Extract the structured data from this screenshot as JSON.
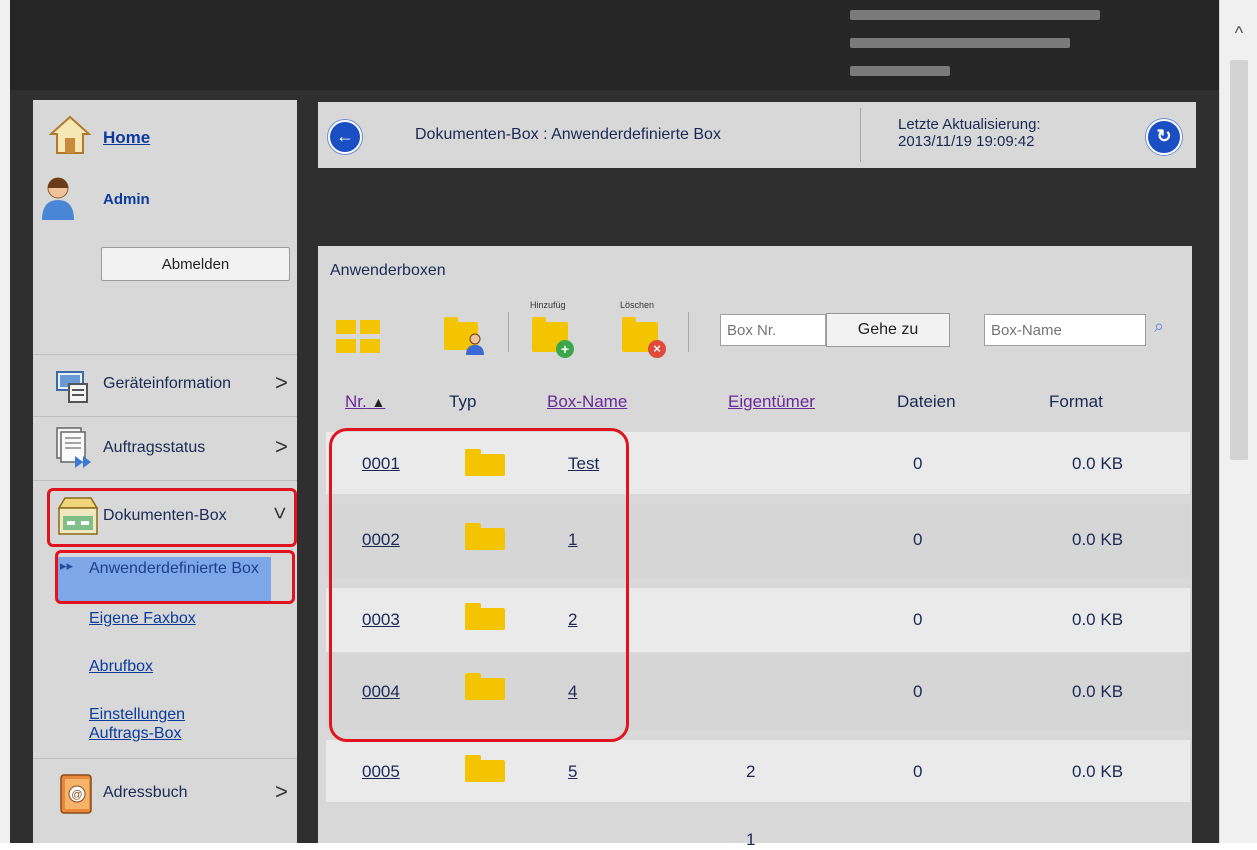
{
  "header": {
    "title": "Dokumenten-Box : Anwenderdefinierte Box",
    "update_label": "Letzte Aktualisierung:",
    "update_time": "2013/11/19 19:09:42"
  },
  "sidebar": {
    "home": "Home",
    "user": "Admin",
    "logout": "Abmelden",
    "menu": [
      {
        "label": "Geräteinformation",
        "icon": "device-info-icon"
      },
      {
        "label": "Auftragsstatus",
        "icon": "job-status-icon"
      },
      {
        "label": "Dokumenten-Box",
        "icon": "document-box-icon"
      },
      {
        "label": "Adressbuch",
        "icon": "address-book-icon"
      }
    ],
    "submenu": {
      "selected": "Anwenderdefinierte Box",
      "fax": "Eigene Faxbox",
      "polling": "Abrufbox",
      "settings": "Einstellungen Auftrags-Box"
    }
  },
  "panel": {
    "title": "Anwenderboxen",
    "tools": {
      "add": "Hinzufüg",
      "delete": "Löschen"
    },
    "box_nr_placeholder": "Box Nr.",
    "goto": "Gehe zu",
    "box_name_placeholder": "Box-Name",
    "columns": [
      "Nr.",
      "Typ",
      "Box-Name",
      "Eigentümer",
      "Dateien",
      "Format"
    ],
    "rows": [
      {
        "nr": "0001",
        "name": "Test",
        "owner": "",
        "files": "0",
        "format": "0.0 KB"
      },
      {
        "nr": "0002",
        "name": "1",
        "owner": "",
        "files": "0",
        "format": "0.0 KB"
      },
      {
        "nr": "0003",
        "name": "2",
        "owner": "",
        "files": "0",
        "format": "0.0 KB"
      },
      {
        "nr": "0004",
        "name": "4",
        "owner": "",
        "files": "0",
        "format": "0.0 KB"
      },
      {
        "nr": "0005",
        "name": "5",
        "owner": "2",
        "files": "0",
        "format": "0.0 KB"
      }
    ],
    "page": "1"
  },
  "colors": {
    "accent": "#1a4fc4",
    "highlight": "#e0141e",
    "selected": "#7da7e6"
  }
}
